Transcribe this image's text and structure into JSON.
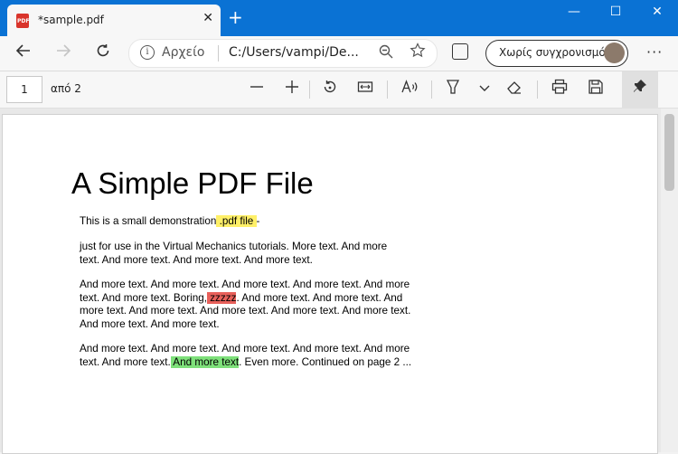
{
  "browser": {
    "tab": {
      "title": "*sample.pdf",
      "close": "✕",
      "icon": "pdf-file-icon",
      "icon_text": "PDF"
    },
    "new_tab": "+",
    "window_controls": {
      "minimize": "—",
      "maximize": "☐",
      "close": "✕"
    },
    "address": {
      "scheme": "Αρχείο",
      "url": "C:/Users/vampi/De...",
      "info": "i"
    },
    "profile_label": "Χωρίς συγχρονισμό",
    "accent_color": "#0a72d4"
  },
  "pdf_toolbar": {
    "page_number": "1",
    "page_of": "από 2",
    "tools": [
      "zoom-out",
      "zoom-in",
      "rotate",
      "fit-to-page",
      "read-aloud",
      "draw",
      "draw-options",
      "erase",
      "print",
      "save",
      "pin"
    ]
  },
  "document": {
    "title": "A Simple PDF File",
    "p1": {
      "before": "This is a small demonstration",
      "highlight": " .pdf file ",
      "after": "-"
    },
    "p2": "just for use in the Virtual Mechanics tutorials. More text. And more text. And more text. And more text. And more text.",
    "p3": {
      "before": "And more text. And more text. And more text. And more text. And more text. And more text. Boring,",
      "highlight": " zzzzz",
      "after": ". And more text. And more text. And more text. And more text. And more text. And more text. And more text. And more text. And more text."
    },
    "p4": {
      "before": "And more text. And more text. And more text. And more text. And more text. And more text.",
      "highlight": " And more text",
      "after": ". Even more. Continued on page 2 ..."
    },
    "highlight_colors": {
      "yellow": "#fff068",
      "red": "#e8605a",
      "green": "#7ee07a"
    }
  }
}
